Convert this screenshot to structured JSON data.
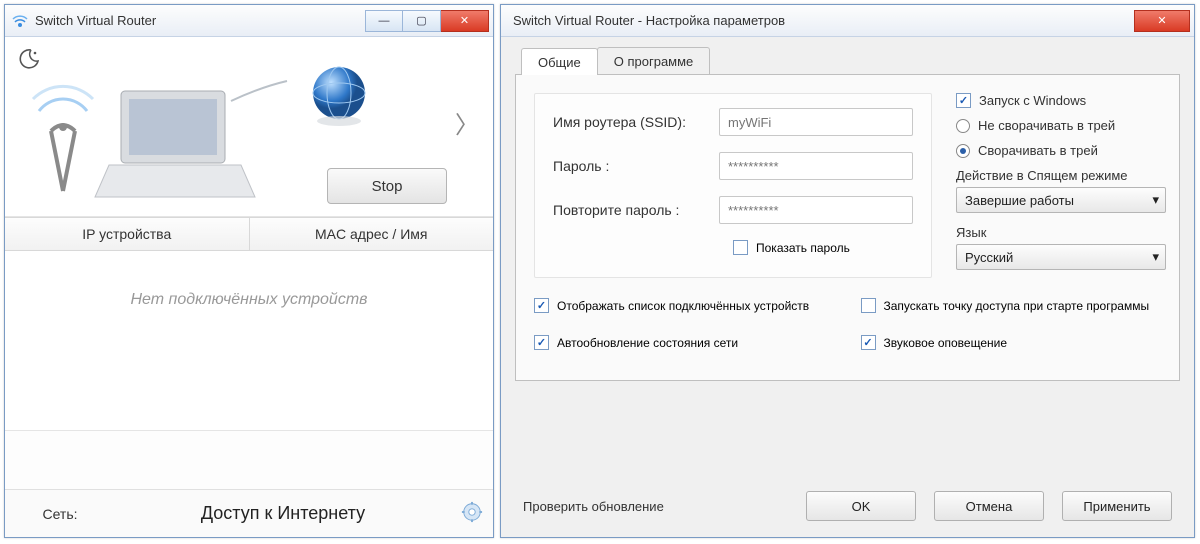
{
  "main": {
    "title": "Switch Virtual Router",
    "stop_btn": "Stop",
    "table": {
      "col_ip": "IP устройства",
      "col_mac": "MAC адрес / Имя",
      "empty": "Нет подключённых устройств"
    },
    "network_label": "Сеть:",
    "network_value": "Доступ к Интернету"
  },
  "settings": {
    "title": "Switch Virtual Router - Настройка параметров",
    "tabs": {
      "general": "Общие",
      "about": "О программе"
    },
    "form": {
      "ssid_label": "Имя роутера (SSID):",
      "ssid_placeholder": "myWiFi",
      "password_label": "Пароль :",
      "password_placeholder": "**********",
      "password2_label": "Повторите пароль :",
      "password2_placeholder": "**********",
      "show_password": "Показать пароль"
    },
    "options": {
      "start_windows": "Запуск с Windows",
      "no_tray": "Не сворачивать в трей",
      "to_tray": "Сворачивать в трей",
      "sleep_label": "Действие в Спящем режиме",
      "sleep_value": "Завершие работы",
      "lang_label": "Язык",
      "lang_value": "Русский"
    },
    "checks": {
      "show_devices": "Отображать список подключённых устройств",
      "autostart_ap": "Запускать точку доступа при старте программы",
      "auto_refresh": "Автообновление состояния сети",
      "sound": "Звуковое оповещение"
    },
    "buttons": {
      "check_update": "Проверить обновление",
      "ok": "OK",
      "cancel": "Отмена",
      "apply": "Применить"
    }
  }
}
